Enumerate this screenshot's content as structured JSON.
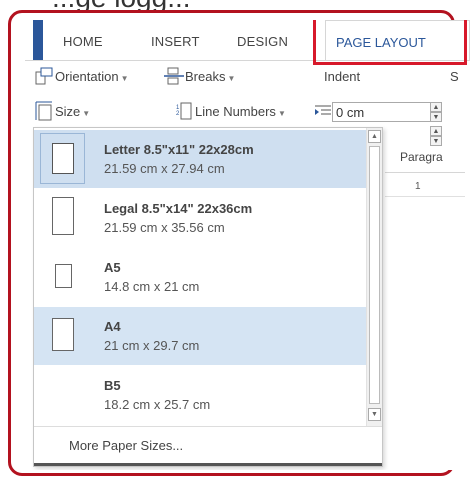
{
  "page_top_text": "...ge logg...",
  "tabs": [
    {
      "label": "HOME"
    },
    {
      "label": "INSERT"
    },
    {
      "label": "DESIGN"
    },
    {
      "label": "PAGE LAYOUT",
      "active": true
    }
  ],
  "ribbon": {
    "orientation": "Orientation",
    "breaks": "Breaks",
    "size": "Size",
    "line_numbers": "Line Numbers",
    "indent_label": "Indent",
    "indent_value": "0 cm",
    "spacing_partial": "S",
    "paragraph_partial": "Paragra",
    "ruler_mark": "1"
  },
  "size_menu": {
    "items": [
      {
        "name": "Letter 8.5\"x11\" 22x28cm",
        "dims": "21.59 cm x 27.94 cm"
      },
      {
        "name": "Legal 8.5\"x14\" 22x36cm",
        "dims": "21.59 cm x 35.56 cm"
      },
      {
        "name": "A5",
        "dims": "14.8 cm x 21 cm"
      },
      {
        "name": "A4",
        "dims": "21 cm x 29.7 cm"
      },
      {
        "name": "B5",
        "dims": "18.2 cm x 25.7 cm"
      }
    ],
    "more": "More Paper Sizes..."
  },
  "colors": {
    "highlight_border": "#d7192b",
    "frame_border": "#b3121f",
    "accent": "#2b579a",
    "selected_bg": "#cfdff0"
  }
}
